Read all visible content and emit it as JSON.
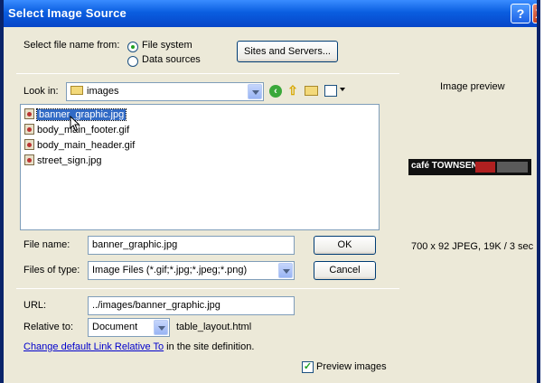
{
  "window": {
    "title": "Select Image Source",
    "help_glyph": "?",
    "close_glyph": "X"
  },
  "select_from": {
    "label": "Select file name from:",
    "options": [
      "File system",
      "Data sources"
    ],
    "selected": "File system"
  },
  "sites_servers_button": "Sites and Servers...",
  "look_in": {
    "label": "Look in:",
    "value": "images"
  },
  "files": [
    "banner_graphic.jpg",
    "body_main_footer.gif",
    "body_main_header.gif",
    "street_sign.jpg"
  ],
  "selected_file": "banner_graphic.jpg",
  "file_name": {
    "label": "File name:",
    "value": "banner_graphic.jpg"
  },
  "files_of_type": {
    "label": "Files of type:",
    "value": "Image Files (*.gif;*.jpg;*.jpeg;*.png)"
  },
  "ok_button": "OK",
  "cancel_button": "Cancel",
  "url": {
    "label": "URL:",
    "value": "../images/banner_graphic.jpg"
  },
  "relative_to": {
    "label": "Relative to:",
    "value": "Document",
    "document_name": "table_layout.html"
  },
  "change_link": {
    "link_text": "Change default Link Relative To",
    "suffix": " in the site definition."
  },
  "preview_images": {
    "label": "Preview images",
    "checked": true
  },
  "preview": {
    "title": "Image preview",
    "banner_text": "café TOWNSEND",
    "info": "700 x 92 JPEG, 19K / 3 sec"
  },
  "colors": {
    "titlebar": "#0a5ee0",
    "selection": "#316ac5",
    "dialog_bg": "#ece9d8"
  }
}
